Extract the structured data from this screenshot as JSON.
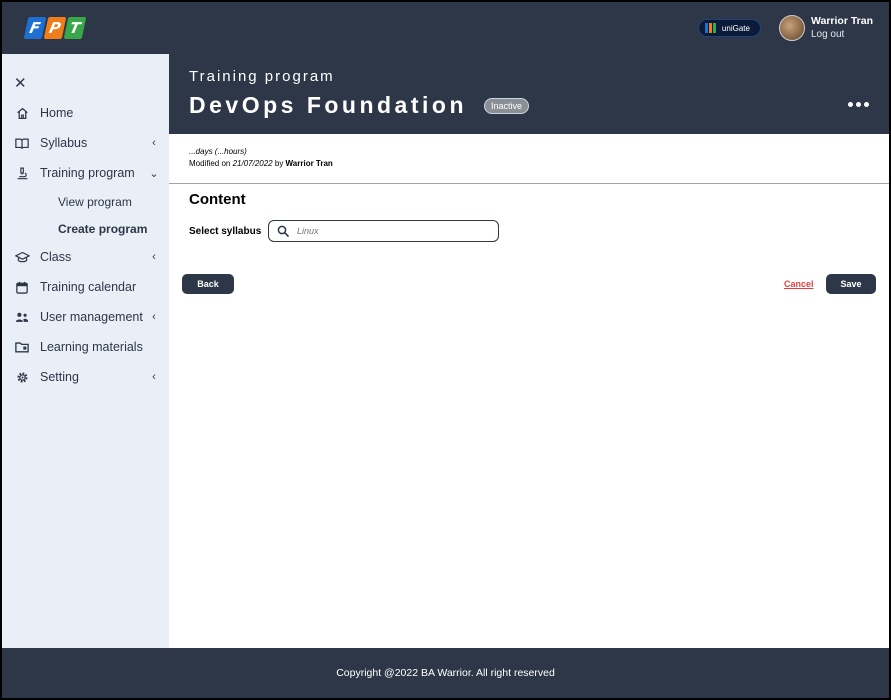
{
  "header": {
    "logo_letters": [
      "F",
      "P",
      "T"
    ],
    "unigate_label": "uniGate",
    "user_name": "Warrior Tran",
    "logout_label": "Log out"
  },
  "sidebar": {
    "items": [
      {
        "label": "Home",
        "icon": "home-icon",
        "chevron": ""
      },
      {
        "label": "Syllabus",
        "icon": "book-icon",
        "chevron": "‹"
      },
      {
        "label": "Training program",
        "icon": "microscope-icon",
        "chevron": "⌄"
      },
      {
        "label": "Class",
        "icon": "graduation-cap-icon",
        "chevron": "‹"
      },
      {
        "label": "Training calendar",
        "icon": "calendar-icon",
        "chevron": ""
      },
      {
        "label": "User management",
        "icon": "users-icon",
        "chevron": "‹"
      },
      {
        "label": "Learning materials",
        "icon": "folder-icon",
        "chevron": ""
      },
      {
        "label": "Setting",
        "icon": "gear-icon",
        "chevron": "‹"
      }
    ],
    "sub_items": [
      {
        "label": "View program"
      },
      {
        "label": "Create program",
        "active": true
      }
    ]
  },
  "main": {
    "title_small": "Training program",
    "title_big": "DevOps Foundation",
    "status": "Inactive",
    "meta_duration": "...days (...hours)",
    "meta_modified_prefix": "Modified on ",
    "meta_modified_date": "21/07/2022",
    "meta_modified_by": " by ",
    "meta_modified_user": "Warrior Tran",
    "content_heading": "Content",
    "select_label": "Select syllabus",
    "search_placeholder": "Linux",
    "back_label": "Back",
    "cancel_label": "Cancel",
    "save_label": "Save"
  },
  "footer": {
    "copyright": "Copyright @2022 BA Warrior. All right reserved"
  },
  "colors": {
    "header_bg": "#2d3748",
    "sidebar_bg": "#e9eef7",
    "cancel_red": "#e53e3e",
    "logo_blue": "#1e6fd1",
    "logo_orange": "#f07c1a",
    "logo_green": "#3aa64a"
  }
}
